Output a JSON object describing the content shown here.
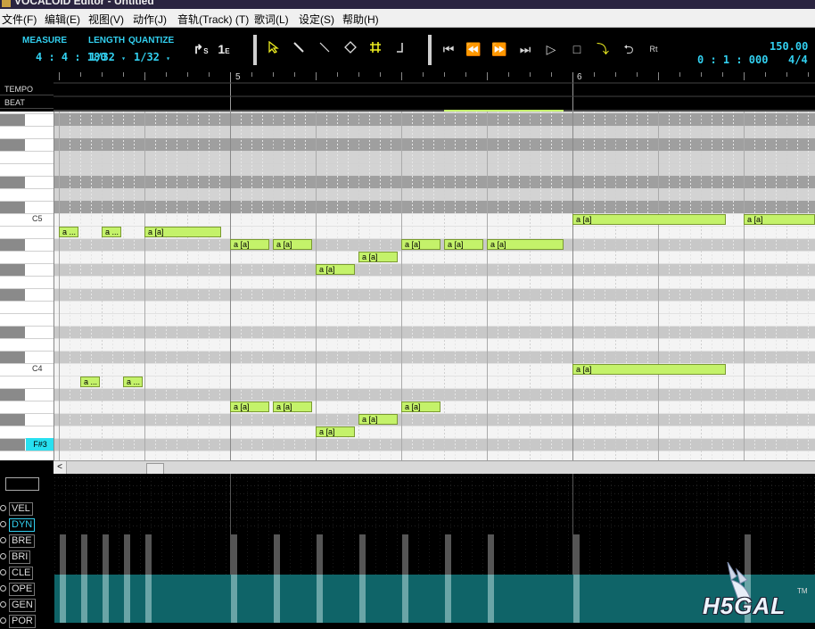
{
  "window": {
    "title": "VOCALOID Editor - Untitled"
  },
  "menu": [
    "文件(F)",
    "编辑(E)",
    "视图(V)",
    "动作(J)",
    "音轨(Track) (T)",
    "歌词(L)",
    "设定(S)",
    "帮助(H)"
  ],
  "toolbar": {
    "measure_label": "MEASURE",
    "measure_value": "4 : 4 : 180",
    "length_label": "LENGTH",
    "length_value": "1/32",
    "quantize_label": "QUANTIZE",
    "quantize_value": "1/32",
    "start_marker": "S",
    "end_marker": "E",
    "time": "0 : 1 : 000",
    "tempo": "150.00",
    "beat": "4/4",
    "tools": [
      "arrow-icon",
      "pencil-icon",
      "line-icon",
      "eraser-icon",
      "grid-icon",
      "vibrato-icon"
    ],
    "transport": [
      "skip-start-icon",
      "rewind-icon",
      "fast-forward-icon",
      "skip-end-icon",
      "play-icon",
      "stop-icon",
      "record-icon",
      "loop-icon",
      "realtime-icon"
    ],
    "realtime_label": "Rt"
  },
  "ruler": {
    "tempo_label": "TEMPO",
    "beat_label": "BEAT",
    "measures": [
      "5",
      "6"
    ]
  },
  "keyboard": {
    "labels": [
      "C5",
      "C4"
    ],
    "selected_key": "F#3"
  },
  "notes": [
    {
      "lyric": "a",
      "phoneme": "...",
      "row": 9
    },
    {
      "lyric": "a",
      "phoneme": "...",
      "row": 9
    },
    {
      "lyric": "a",
      "phoneme": "[a]",
      "row": 9
    },
    {
      "lyric": "a",
      "phoneme": "[a]",
      "row": 10
    },
    {
      "lyric": "a",
      "phoneme": "[a]",
      "row": 10
    },
    {
      "lyric": "a",
      "phoneme": "[a]",
      "row": 12
    },
    {
      "lyric": "a",
      "phoneme": "[a]",
      "row": 11
    },
    {
      "lyric": "a",
      "phoneme": "[a]",
      "row": 10
    },
    {
      "lyric": "a",
      "phoneme": "[a]",
      "row": 10
    },
    {
      "lyric": "a",
      "phoneme": "[a]",
      "row": 10
    },
    {
      "lyric": "a",
      "phoneme": "[a]",
      "row": 8
    },
    {
      "lyric": "a",
      "phoneme": "[a]",
      "row": 8
    },
    {
      "lyric": "a",
      "phoneme": "...",
      "row": 21
    },
    {
      "lyric": "a",
      "phoneme": "...",
      "row": 21
    },
    {
      "lyric": "a",
      "phoneme": "[a]",
      "row": 23
    },
    {
      "lyric": "a",
      "phoneme": "[a]",
      "row": 23
    },
    {
      "lyric": "a",
      "phoneme": "[a]",
      "row": 25
    },
    {
      "lyric": "a",
      "phoneme": "[a]",
      "row": 24
    },
    {
      "lyric": "a",
      "phoneme": "[a]",
      "row": 23
    },
    {
      "lyric": "a",
      "phoneme": "[a]",
      "row": 20
    }
  ],
  "scrollbar": {
    "left_arrow": "<"
  },
  "control_track": {
    "parameters": [
      "VEL",
      "DYN",
      "BRE",
      "BRI",
      "CLE",
      "OPE",
      "GEN",
      "POR"
    ],
    "active": "DYN"
  },
  "watermark": {
    "text": "H5GAL",
    "trademark": "TM"
  },
  "colors": {
    "accent": "#32d0f0",
    "note_fill": "#c4f26a",
    "control_fill": "#0f6468",
    "tool_active": "#ecec20"
  }
}
